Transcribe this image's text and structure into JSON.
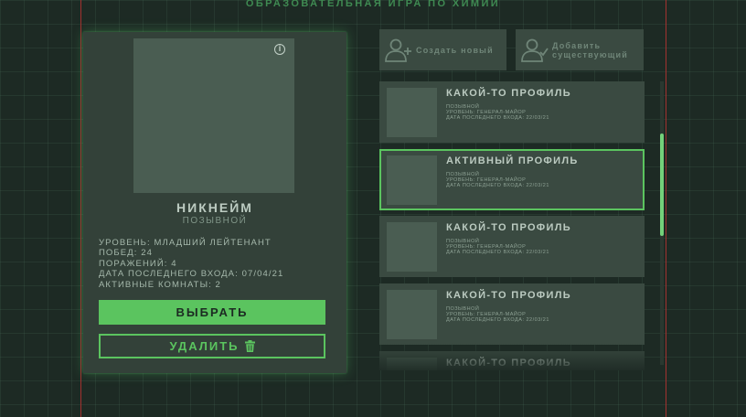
{
  "app": {
    "title": "ОБРАЗОВАТЕЛЬНАЯ ИГРА ПО ХИМИИ"
  },
  "colors": {
    "accent": "#5bc45f",
    "background": "#1d2a24",
    "panel": "#334139",
    "frame": "#a3312f"
  },
  "selected_profile": {
    "info_icon": "info-icon",
    "nickname": "НИКНЕЙМ",
    "callsign": "ПОЗЫВНОЙ",
    "stats": [
      "УРОВЕНЬ: МЛАДШИЙ ЛЕЙТЕНАНТ",
      "ПОБЕД: 24",
      "ПОРАЖЕНИЙ: 4",
      "ДАТА ПОСЛЕДНЕГО ВХОДА: 07/04/21",
      "АКТИВНЫЕ КОМНАТЫ: 2"
    ],
    "select_label": "ВЫБРАТЬ",
    "delete_label": "УДАЛИТЬ",
    "delete_icon": "trash-icon"
  },
  "actions": {
    "create": {
      "label_line1": "Создать новый",
      "icon": "user-plus-icon"
    },
    "add_existing": {
      "label_line1": "Добавить",
      "label_line2": "существующий",
      "icon": "user-check-icon"
    }
  },
  "profiles": [
    {
      "title": "КАКОЙ-ТО ПРОФИЛЬ",
      "callsign": "ПОЗЫВНОЙ",
      "level": "УРОВЕНЬ: ГЕНЕРАЛ-МАЙОР",
      "last_login": "ДАТА ПОСЛЕДНЕГО ВХОДА: 22/03/21",
      "active": false
    },
    {
      "title": "АКТИВНЫЙ ПРОФИЛЬ",
      "callsign": "ПОЗЫВНОЙ",
      "level": "УРОВЕНЬ: ГЕНЕРАЛ-МАЙОР",
      "last_login": "ДАТА ПОСЛЕДНЕГО ВХОДА: 22/03/21",
      "active": true
    },
    {
      "title": "КАКОЙ-ТО ПРОФИЛЬ",
      "callsign": "ПОЗЫВНОЙ",
      "level": "УРОВЕНЬ: ГЕНЕРАЛ-МАЙОР",
      "last_login": "ДАТА ПОСЛЕДНЕГО ВХОДА: 22/03/21",
      "active": false
    },
    {
      "title": "КАКОЙ-ТО ПРОФИЛЬ",
      "callsign": "ПОЗЫВНОЙ",
      "level": "УРОВЕНЬ: ГЕНЕРАЛ-МАЙОР",
      "last_login": "ДАТА ПОСЛЕДНЕГО ВХОДА: 22/03/21",
      "active": false
    },
    {
      "title": "КАКОЙ-ТО ПРОФИЛЬ",
      "callsign": "",
      "level": "",
      "last_login": "",
      "active": false
    }
  ]
}
